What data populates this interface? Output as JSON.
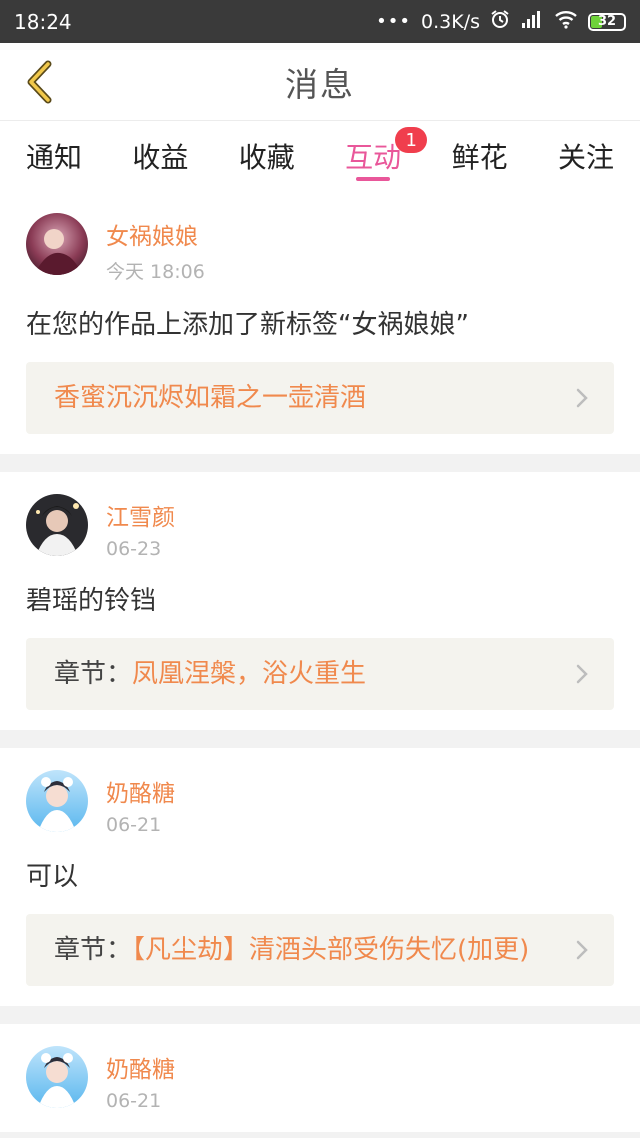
{
  "status_bar": {
    "time": "18:24",
    "dots": "•••",
    "speed": "0.3K/s",
    "battery": "32",
    "battery_level": 0.32
  },
  "header": {
    "title": "消息"
  },
  "tabs": [
    {
      "label": "通知"
    },
    {
      "label": "收益"
    },
    {
      "label": "收藏"
    },
    {
      "label": "互动",
      "badge": "1",
      "active": true
    },
    {
      "label": "鲜花"
    },
    {
      "label": "关注"
    }
  ],
  "colors": {
    "accent_pink": "#e9579a",
    "accent_orange": "#f0894d",
    "badge_red": "#f03e4d"
  },
  "messages": [
    {
      "user": "女祸娘娘",
      "time": "今天 18:06",
      "text": "在您的作品上添加了新标签“女祸娘娘”",
      "ref_label": "",
      "ref_text": "香蜜沉沉烬如霜之一壶清酒",
      "avatar_icon": "user-avatar"
    },
    {
      "user": "江雪颜",
      "time": "06-23",
      "text": "碧瑶的铃铛",
      "ref_label": "章节：",
      "ref_text": "凤凰涅槃，浴火重生",
      "avatar_icon": "user-avatar"
    },
    {
      "user": "奶酪糖",
      "time": "06-21",
      "text": "可以",
      "ref_label": "章节：",
      "ref_text": "【凡尘劫】清酒头部受伤失忆(加更)",
      "avatar_icon": "user-avatar"
    },
    {
      "user": "奶酪糖",
      "time": "06-21",
      "text": "",
      "ref_label": "",
      "ref_text": "",
      "avatar_icon": "user-avatar"
    }
  ]
}
